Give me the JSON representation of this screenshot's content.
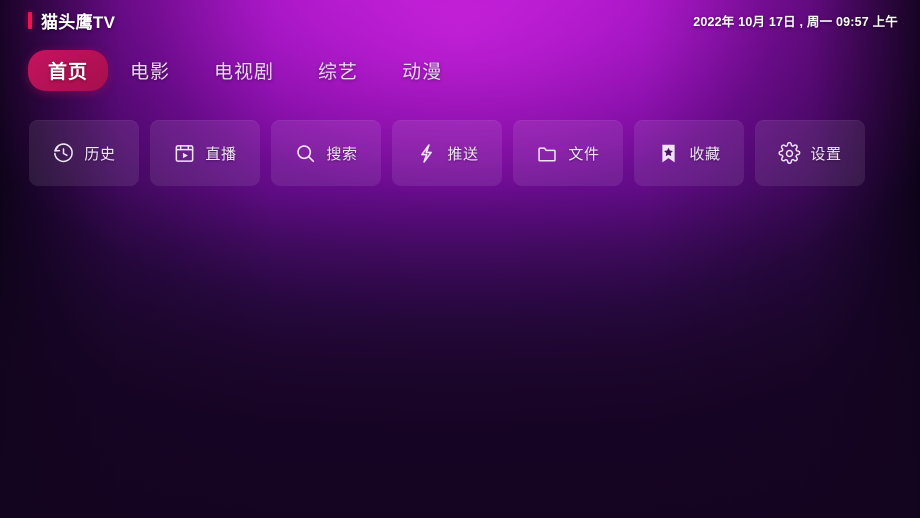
{
  "app": {
    "brand": "猫头鹰TV",
    "brand_accent_color": "#ec1550",
    "active_tab_color": "#b01050",
    "background_top_color": "#c41ad8",
    "background_bottom_color": "#19042a"
  },
  "header": {
    "datetime": "2022年 10月 17日 , 周一 09:57 上午"
  },
  "tabs": [
    {
      "label": "首页",
      "name": "tab-home",
      "active": true
    },
    {
      "label": "电影",
      "name": "tab-movie",
      "active": false
    },
    {
      "label": "电视剧",
      "name": "tab-tv",
      "active": false
    },
    {
      "label": "综艺",
      "name": "tab-variety",
      "active": false
    },
    {
      "label": "动漫",
      "name": "tab-anime",
      "active": false
    }
  ],
  "quick_actions": [
    {
      "label": "历史",
      "icon": "history-icon"
    },
    {
      "label": "直播",
      "icon": "live-tv-icon"
    },
    {
      "label": "搜索",
      "icon": "search-icon"
    },
    {
      "label": "推送",
      "icon": "push-zap-icon"
    },
    {
      "label": "文件",
      "icon": "folder-icon"
    },
    {
      "label": "收藏",
      "icon": "bookmark-star-icon"
    },
    {
      "label": "设置",
      "icon": "gear-icon"
    }
  ]
}
